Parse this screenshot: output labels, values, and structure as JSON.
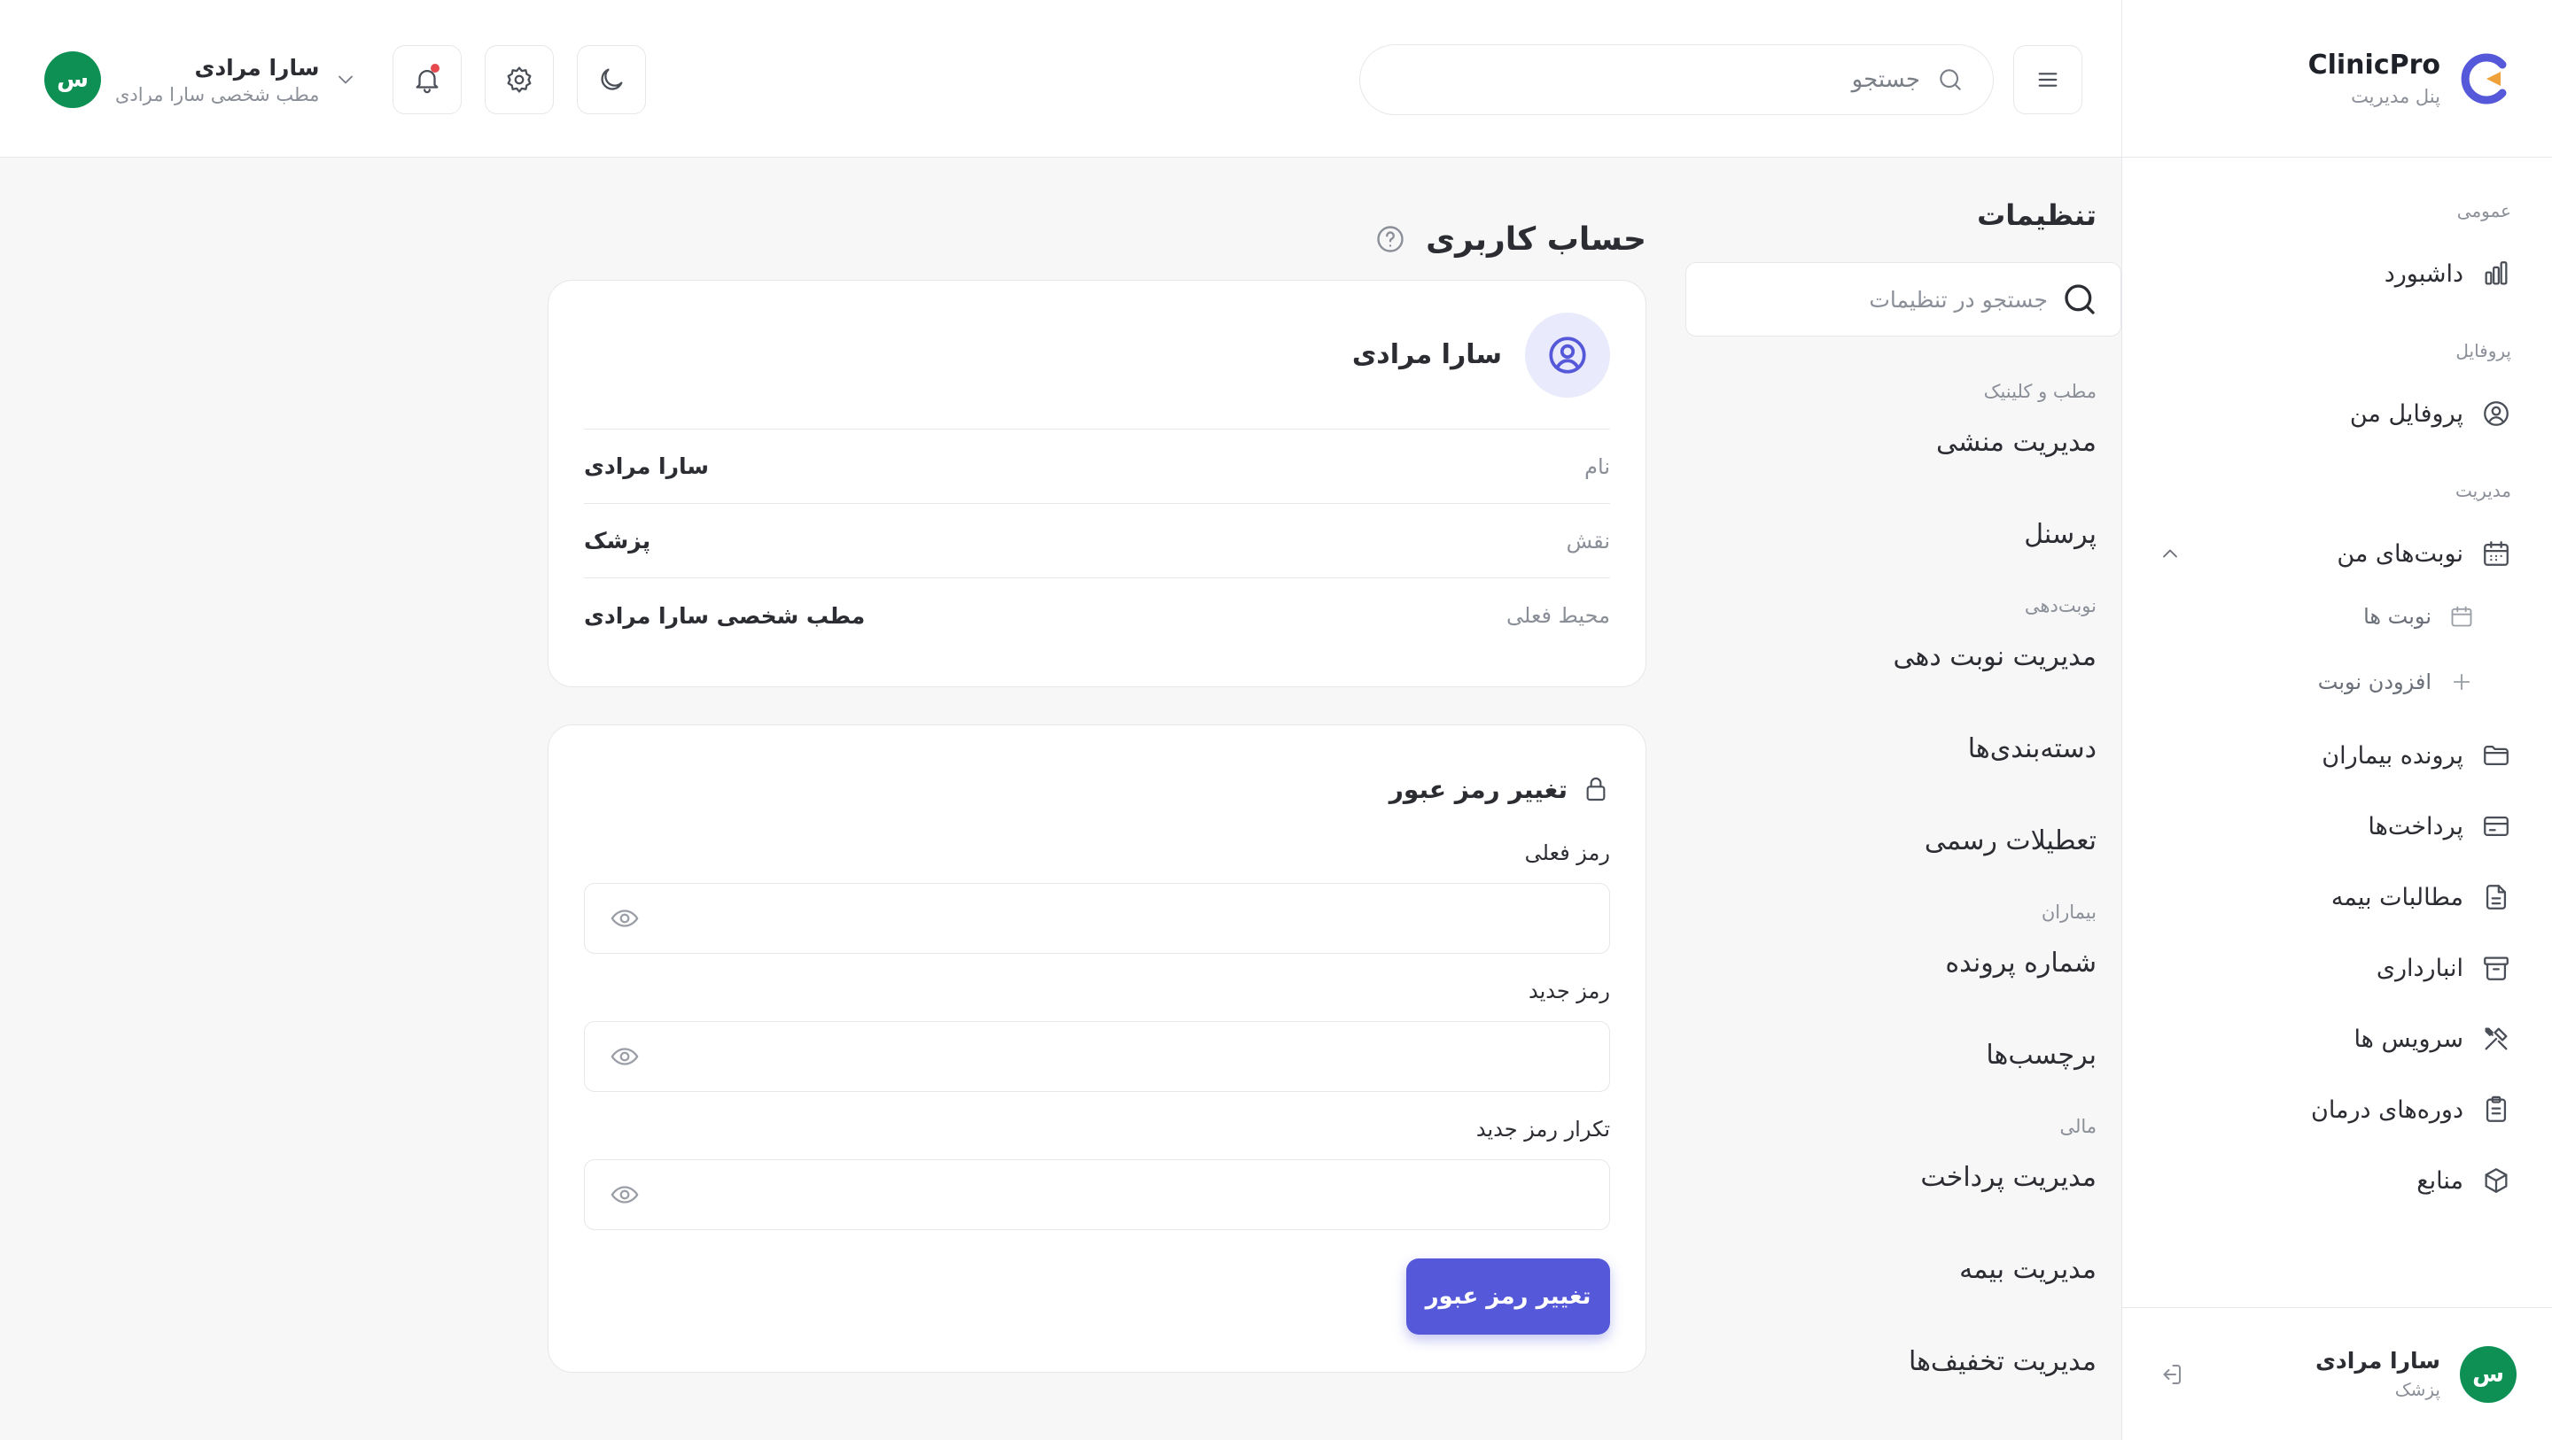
{
  "brand": {
    "name": "ClinicPro",
    "subtitle": "پنل مدیریت"
  },
  "topbar": {
    "search_placeholder": "جستجو",
    "user": {
      "name": "سارا مرادی",
      "workspace": "مطب شخصی سارا مرادی",
      "initial": "س"
    }
  },
  "sidebar": {
    "groups": {
      "general": "عمومی",
      "profile": "پروفایل",
      "management": "مدیریت"
    },
    "items": {
      "dashboard": "داشبورد",
      "my_profile": "پروفایل من",
      "my_appointments": "نوبت‌های من",
      "appointments": "نوبت ها",
      "add_appointment": "افزودن نوبت",
      "patient_records": "پرونده بیماران",
      "payments": "پرداخت‌ها",
      "insurance_claims": "مطالبات بیمه",
      "inventory": "انبارداری",
      "services": "سرویس ها",
      "treatment_courses": "دوره‌های درمان",
      "resources": "منابع"
    },
    "user": {
      "name": "سارا مرادی",
      "role": "پزشک",
      "initial": "س"
    }
  },
  "settings": {
    "title": "تنظیمات",
    "search_placeholder": "جستجو در تنظیمات",
    "groups": {
      "clinic": "مطب و کلینیک",
      "scheduling": "نوبت‌دهی",
      "patients": "بیماران",
      "financial": "مالی"
    },
    "items": {
      "secretary_management": "مدیریت منشی",
      "staff": "پرسنل",
      "appointment_management": "مدیریت نوبت دهی",
      "categories": "دسته‌بندی‌ها",
      "holidays": "تعطیلات رسمی",
      "record_number": "شماره پرونده",
      "tags": "برچسب‌ها",
      "payment_management": "مدیریت پرداخت",
      "insurance_management": "مدیریت بیمه",
      "discount_management": "مدیریت تخفیف‌ها"
    }
  },
  "main": {
    "title": "حساب کاربری",
    "profile": {
      "name": "سارا مرادی",
      "rows": [
        {
          "label": "نام",
          "value": "سارا مرادی"
        },
        {
          "label": "نقش",
          "value": "پزشک"
        },
        {
          "label": "محیط فعلی",
          "value": "مطب شخصی سارا مرادی"
        }
      ]
    },
    "password": {
      "title": "تغییر رمز عبور",
      "current_label": "رمز فعلی",
      "new_label": "رمز جدید",
      "repeat_label": "تکرار رمز جدید",
      "submit": "تغییر رمز عبور"
    }
  },
  "colors": {
    "accent": "#5558d9",
    "avatar_green": "#0e8f54"
  }
}
